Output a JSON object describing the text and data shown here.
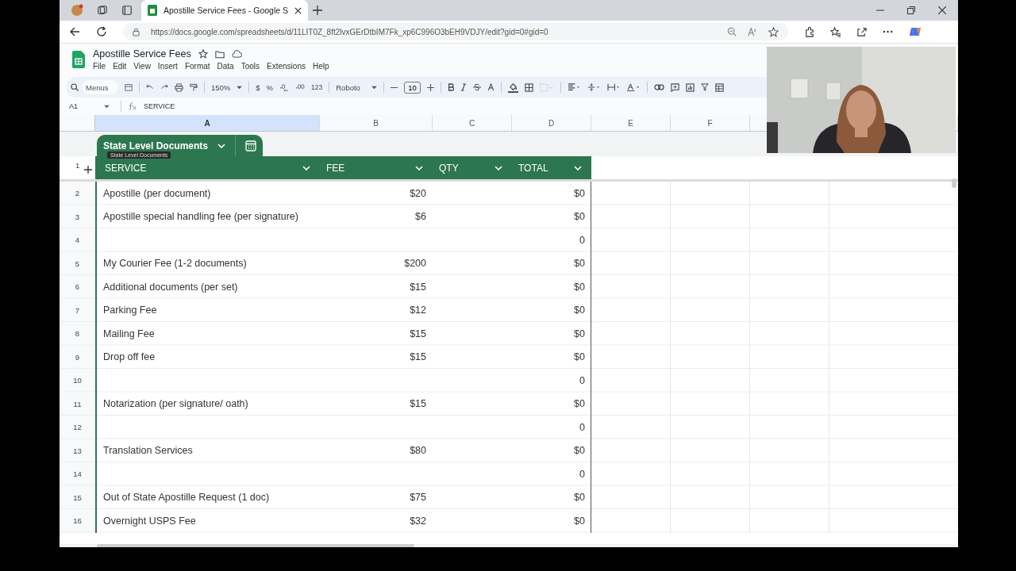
{
  "browser": {
    "tabs": [
      {
        "title": "Apostille Service Fees - Google S",
        "selected": true
      }
    ],
    "url": "https://docs.google.com/spreadsheets/d/11LIT0Z_8ft2lvxGErDtbIM7Fk_xp6C996O3bEH9VDJY/edit?gid=0#gid=0"
  },
  "doc": {
    "title": "Apostille Service Fees",
    "menus": [
      "File",
      "Edit",
      "View",
      "Insert",
      "Format",
      "Data",
      "Tools",
      "Extensions",
      "Help"
    ]
  },
  "toolbar": {
    "search_placeholder": "Menus",
    "zoom": "150%",
    "number_format": "123",
    "font": "Roboto",
    "font_size": "10",
    "currency": "$",
    "percent": "%"
  },
  "formula_bar": {
    "cell": "A1",
    "content": "SERVICE"
  },
  "sheet": {
    "column_letters": [
      "A",
      "B",
      "C",
      "D",
      "E",
      "F"
    ],
    "table_name": "State Level Documents",
    "tooltip": "State Level Documents",
    "header_row": "1",
    "columns": [
      "SERVICE",
      "FEE",
      "QTY",
      "TOTAL"
    ],
    "rows": [
      {
        "number": "2",
        "service": "Apostille (per document)",
        "fee": "$20",
        "total": "$0"
      },
      {
        "number": "3",
        "service": "Apostille special handling fee (per signature)",
        "fee": "$6",
        "total": "$0"
      },
      {
        "number": "4",
        "service": "",
        "fee": "",
        "total": "0"
      },
      {
        "number": "5",
        "service": "My Courier Fee (1-2 documents)",
        "fee": "$200",
        "total": "$0"
      },
      {
        "number": "6",
        "service": "Additional documents (per set)",
        "fee": "$15",
        "total": "$0"
      },
      {
        "number": "7",
        "service": "Parking Fee",
        "fee": "$12",
        "total": "$0"
      },
      {
        "number": "8",
        "service": "Mailing Fee",
        "fee": "$15",
        "total": "$0"
      },
      {
        "number": "9",
        "service": "Drop off fee",
        "fee": "$15",
        "total": "$0"
      },
      {
        "number": "10",
        "service": "",
        "fee": "",
        "total": "0"
      },
      {
        "number": "11",
        "service": "Notarization (per signature/ oath)",
        "fee": "$15",
        "total": "$0"
      },
      {
        "number": "12",
        "service": "",
        "fee": "",
        "total": "0"
      },
      {
        "number": "13",
        "service": "Translation Services",
        "fee": "$80",
        "total": "$0"
      },
      {
        "number": "14",
        "service": "",
        "fee": "",
        "total": "0"
      },
      {
        "number": "15",
        "service": "Out of State Apostille Request (1 doc)",
        "fee": "$75",
        "total": "$0"
      },
      {
        "number": "16",
        "service": "Overnight USPS Fee",
        "fee": "$32",
        "total": "$0"
      }
    ]
  }
}
